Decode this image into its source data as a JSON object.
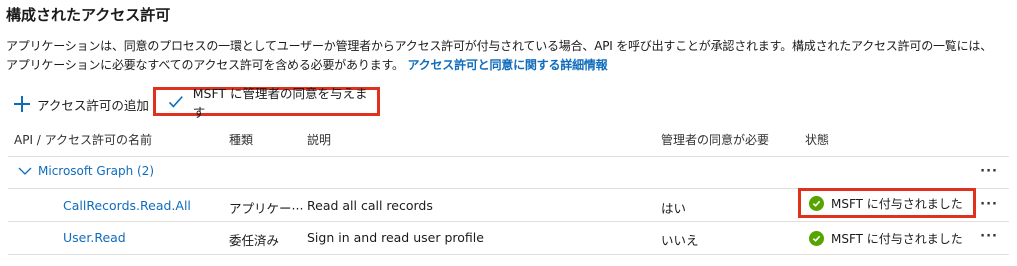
{
  "section": {
    "title": "構成されたアクセス許可",
    "description_line1": "アプリケーションは、同意のプロセスの一環としてユーザーか管理者からアクセス許可が付与されている場合、API を呼び出すことが承認されます。構成されたアクセス許可の一覧には、",
    "description_line2": "アプリケーションに必要なすべてのアクセス許可を含める必要があります。",
    "description_link": "アクセス許可と同意に関する詳細情報"
  },
  "toolbar": {
    "add_label": "アクセス許可の追加",
    "consent_label": "MSFT に管理者の同意を与えます"
  },
  "table": {
    "columns": {
      "name": "API / アクセス許可の名前",
      "type": "種類",
      "description": "説明",
      "admin_consent": "管理者の同意が必要",
      "status": "状態"
    },
    "group": {
      "label": "Microsoft Graph (2)",
      "more": "···"
    },
    "rows": [
      {
        "name": "CallRecords.Read.All",
        "type": "アプリケー···",
        "description": "Read all call records",
        "admin_consent": "はい",
        "status": "MSFT に付与されました",
        "more": "···"
      },
      {
        "name": "User.Read",
        "type": "委任済み",
        "description": "Sign in and read user profile",
        "admin_consent": "いいえ",
        "status": "MSFT に付与されました",
        "more": "···"
      }
    ]
  },
  "colors": {
    "accent": "#0f6cbd",
    "highlight_border": "#e0301e",
    "status_ok": "#57a300"
  }
}
